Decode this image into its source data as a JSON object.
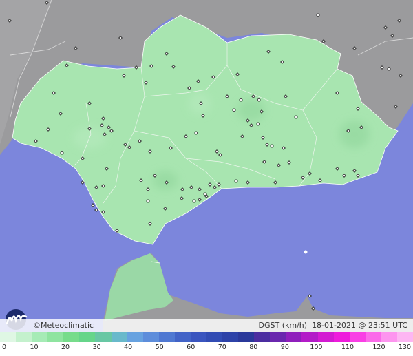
{
  "credits": {
    "brand": "©Meteoclimatic",
    "variable": "DGST (km/h)",
    "datetime": "18-01-2021 @ 23:51 UTC"
  },
  "legend": {
    "ticks": [
      "0",
      "10",
      "20",
      "30",
      "40",
      "50",
      "60",
      "70",
      "80",
      "90",
      "100",
      "110",
      "120",
      "130"
    ],
    "colors": [
      "#dff7e4",
      "#c4f1cd",
      "#a6ebb6",
      "#8fe4a0",
      "#77dc8b",
      "#66d58a",
      "#68c7a4",
      "#69b9cb",
      "#67a2e0",
      "#5d8ddb",
      "#4f78d2",
      "#4263c7",
      "#3a55bf",
      "#324cb4",
      "#2d42a8",
      "#2a389a",
      "#4b2da0",
      "#6a27ae",
      "#8f1fbc",
      "#b31bc8",
      "#d31ad2",
      "#ee1bdc",
      "#f93fe5",
      "#fb6aea",
      "#fd95ef",
      "#fdb6f3"
    ]
  },
  "colors": {
    "sea": "#7c86dc",
    "land_green": "#a6e3ad",
    "land_gray": "#9a9a9c"
  },
  "icons": {
    "logo": "meteoclimatic-logo",
    "station": "station-marker"
  }
}
